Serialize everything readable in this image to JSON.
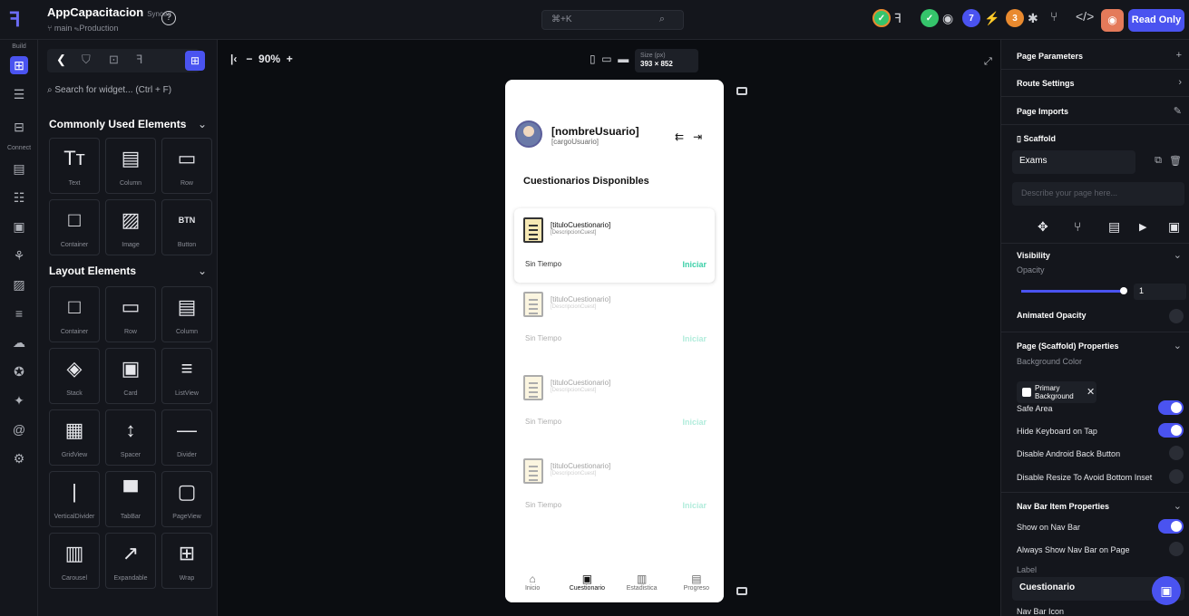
{
  "app": {
    "title": "AppCapacitacion",
    "synced": "Synced",
    "branch": "main",
    "environment": "Production"
  },
  "topbar": {
    "search_shortcut": "⌘+K",
    "badges": [
      {
        "name": "ff-pro-badge",
        "color": "#e98a2f",
        "count": ""
      },
      {
        "name": "agent-badge",
        "color": "#35c46b",
        "count": ""
      },
      {
        "name": "tasks-badge",
        "color": "#4a53f0",
        "count": "7"
      },
      {
        "name": "bugs-badge",
        "color": "#e98a2f",
        "count": "3"
      }
    ],
    "read_only_label": "Read Only"
  },
  "rail": {
    "build_label": "Build",
    "connect_label": "Connect"
  },
  "widget_panel": {
    "search_placeholder": "Search for widget... (Ctrl + F)",
    "sections": [
      {
        "title": "Commonly Used Elements",
        "items": [
          {
            "label": "Text",
            "icon": "text-icon",
            "glyph": "Tт"
          },
          {
            "label": "Column",
            "icon": "column-icon",
            "glyph": "▤"
          },
          {
            "label": "Row",
            "icon": "row-icon",
            "glyph": "▭"
          },
          {
            "label": "Container",
            "icon": "container-icon",
            "glyph": "□"
          },
          {
            "label": "Image",
            "icon": "image-icon",
            "glyph": "▨"
          },
          {
            "label": "Button",
            "icon": "button-icon",
            "glyph": "BTN"
          }
        ]
      },
      {
        "title": "Layout Elements",
        "items": [
          {
            "label": "Container",
            "icon": "container-icon",
            "glyph": "□"
          },
          {
            "label": "Row",
            "icon": "row-icon",
            "glyph": "▭"
          },
          {
            "label": "Column",
            "icon": "column-icon",
            "glyph": "▤"
          },
          {
            "label": "Stack",
            "icon": "stack-icon",
            "glyph": "◈"
          },
          {
            "label": "Card",
            "icon": "card-icon",
            "glyph": "▣"
          },
          {
            "label": "ListView",
            "icon": "listview-icon",
            "glyph": "≡"
          },
          {
            "label": "GridView",
            "icon": "gridview-icon",
            "glyph": "▦"
          },
          {
            "label": "Spacer",
            "icon": "spacer-icon",
            "glyph": "↕"
          },
          {
            "label": "Divider",
            "icon": "divider-icon",
            "glyph": "—"
          },
          {
            "label": "VerticalDivider",
            "icon": "vertical-divider-icon",
            "glyph": "|"
          },
          {
            "label": "TabBar",
            "icon": "tabbar-icon",
            "glyph": "▀"
          },
          {
            "label": "PageView",
            "icon": "pageview-icon",
            "glyph": "▢"
          },
          {
            "label": "Carousel",
            "icon": "carousel-icon",
            "glyph": "▥"
          },
          {
            "label": "Expandable",
            "icon": "expandable-icon",
            "glyph": "↗"
          },
          {
            "label": "Wrap",
            "icon": "wrap-icon",
            "glyph": "⊞"
          }
        ]
      }
    ]
  },
  "canvas": {
    "zoom": "90%",
    "size_label": "Size (px)",
    "size_value": "393 × 852"
  },
  "phone": {
    "user_name": "[nombreUsuario]",
    "user_role": "[cargoUsuario]",
    "section_title": "Cuestionarios Disponibles",
    "cards": [
      {
        "title": "[tituloCuestionario]",
        "desc": "[DescripcionCuest]",
        "time": "Sin Tiempo",
        "button": "Iniciar"
      },
      {
        "title": "[tituloCuestionario]",
        "desc": "[DescripcionCuest]",
        "time": "Sin Tiempo",
        "button": "Iniciar"
      },
      {
        "title": "[tituloCuestionario]",
        "desc": "[DescripcionCuest]",
        "time": "Sin Tiempo",
        "button": "Iniciar"
      },
      {
        "title": "[tituloCuestionario]",
        "desc": "[DescripcionCuest]",
        "time": "Sin Tiempo",
        "button": "Iniciar"
      }
    ],
    "nav": [
      {
        "label": "Inicio",
        "icon": "home-icon",
        "glyph": "⌂"
      },
      {
        "label": "Cuestionario",
        "icon": "quiz-icon",
        "glyph": "▣"
      },
      {
        "label": "Estadistica",
        "icon": "chart-icon",
        "glyph": "▥"
      },
      {
        "label": "Progreso",
        "icon": "progress-icon",
        "glyph": "▤"
      }
    ]
  },
  "properties": {
    "page_parameters": "Page Parameters",
    "route_settings": "Route Settings",
    "page_imports": "Page Imports",
    "scaffold": "Scaffold",
    "page_name": "Exams",
    "describe_placeholder": "Describe your page here...",
    "visibility": "Visibility",
    "opacity_label": "Opacity",
    "opacity_value": "1",
    "animated_opacity": "Animated Opacity",
    "scaffold_props": "Page (Scaffold) Properties",
    "background_color": "Background Color",
    "bg_color_value": "Primary Background",
    "safe_area": "Safe Area",
    "hide_keyboard": "Hide Keyboard on Tap",
    "disable_back": "Disable Android Back Button",
    "disable_resize": "Disable Resize To Avoid Bottom Inset",
    "nav_bar_props": "Nav Bar Item Properties",
    "show_nav": "Show on Nav Bar",
    "always_show_nav": "Always Show Nav Bar on Page",
    "label_title": "Label",
    "label_value": "Cuestionario",
    "nav_bar_icon": "Nav Bar Icon"
  }
}
